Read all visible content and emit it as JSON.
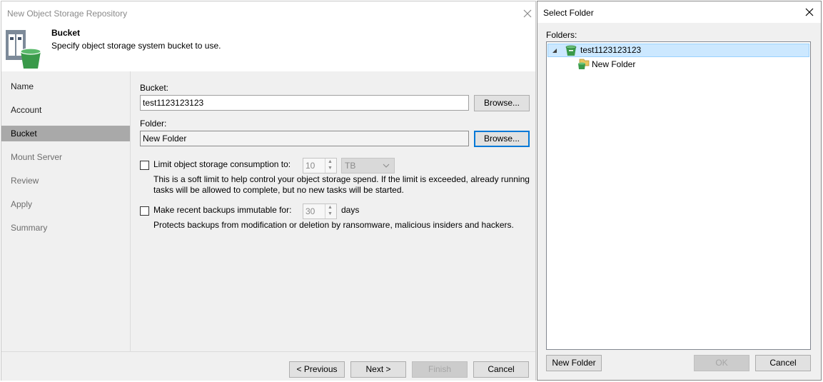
{
  "wizard": {
    "title": "New Object Storage Repository",
    "header": {
      "title": "Bucket",
      "subtitle": "Specify object storage system bucket to use."
    },
    "nav": [
      {
        "label": "Name",
        "state": "enabled"
      },
      {
        "label": "Account",
        "state": "enabled"
      },
      {
        "label": "Bucket",
        "state": "active"
      },
      {
        "label": "Mount Server",
        "state": "disabled"
      },
      {
        "label": "Review",
        "state": "disabled"
      },
      {
        "label": "Apply",
        "state": "disabled"
      },
      {
        "label": "Summary",
        "state": "disabled"
      }
    ],
    "bucket_label": "Bucket:",
    "bucket_value": "test1123123123",
    "folder_label": "Folder:",
    "folder_value": "New Folder",
    "browse_label": "Browse...",
    "limit": {
      "label": "Limit object storage consumption to:",
      "checked": false,
      "value": "10",
      "unit": "TB",
      "desc_line1": "This is a soft limit to help control your object storage spend. If the limit is exceeded, already running",
      "desc_line2": "tasks will be allowed to complete, but no new tasks will be started."
    },
    "immutable": {
      "label": "Make recent backups immutable for:",
      "checked": false,
      "value": "30",
      "unit": "days",
      "desc": "Protects backups from modification or deletion by ransomware, malicious insiders and hackers."
    },
    "buttons": {
      "previous": "< Previous",
      "next": "Next >",
      "finish": "Finish",
      "cancel": "Cancel"
    }
  },
  "dialog": {
    "title": "Select Folder",
    "folders_label": "Folders:",
    "tree": {
      "root": "test1123123123",
      "child": "New Folder"
    },
    "buttons": {
      "new_folder": "New Folder",
      "ok": "OK",
      "cancel": "Cancel"
    }
  },
  "colors": {
    "accent_focus": "#0078d7",
    "nav_active": "#a9a9a9",
    "tree_selection": "#cce8ff",
    "bucket_icon_green": "#3a9a4a"
  }
}
